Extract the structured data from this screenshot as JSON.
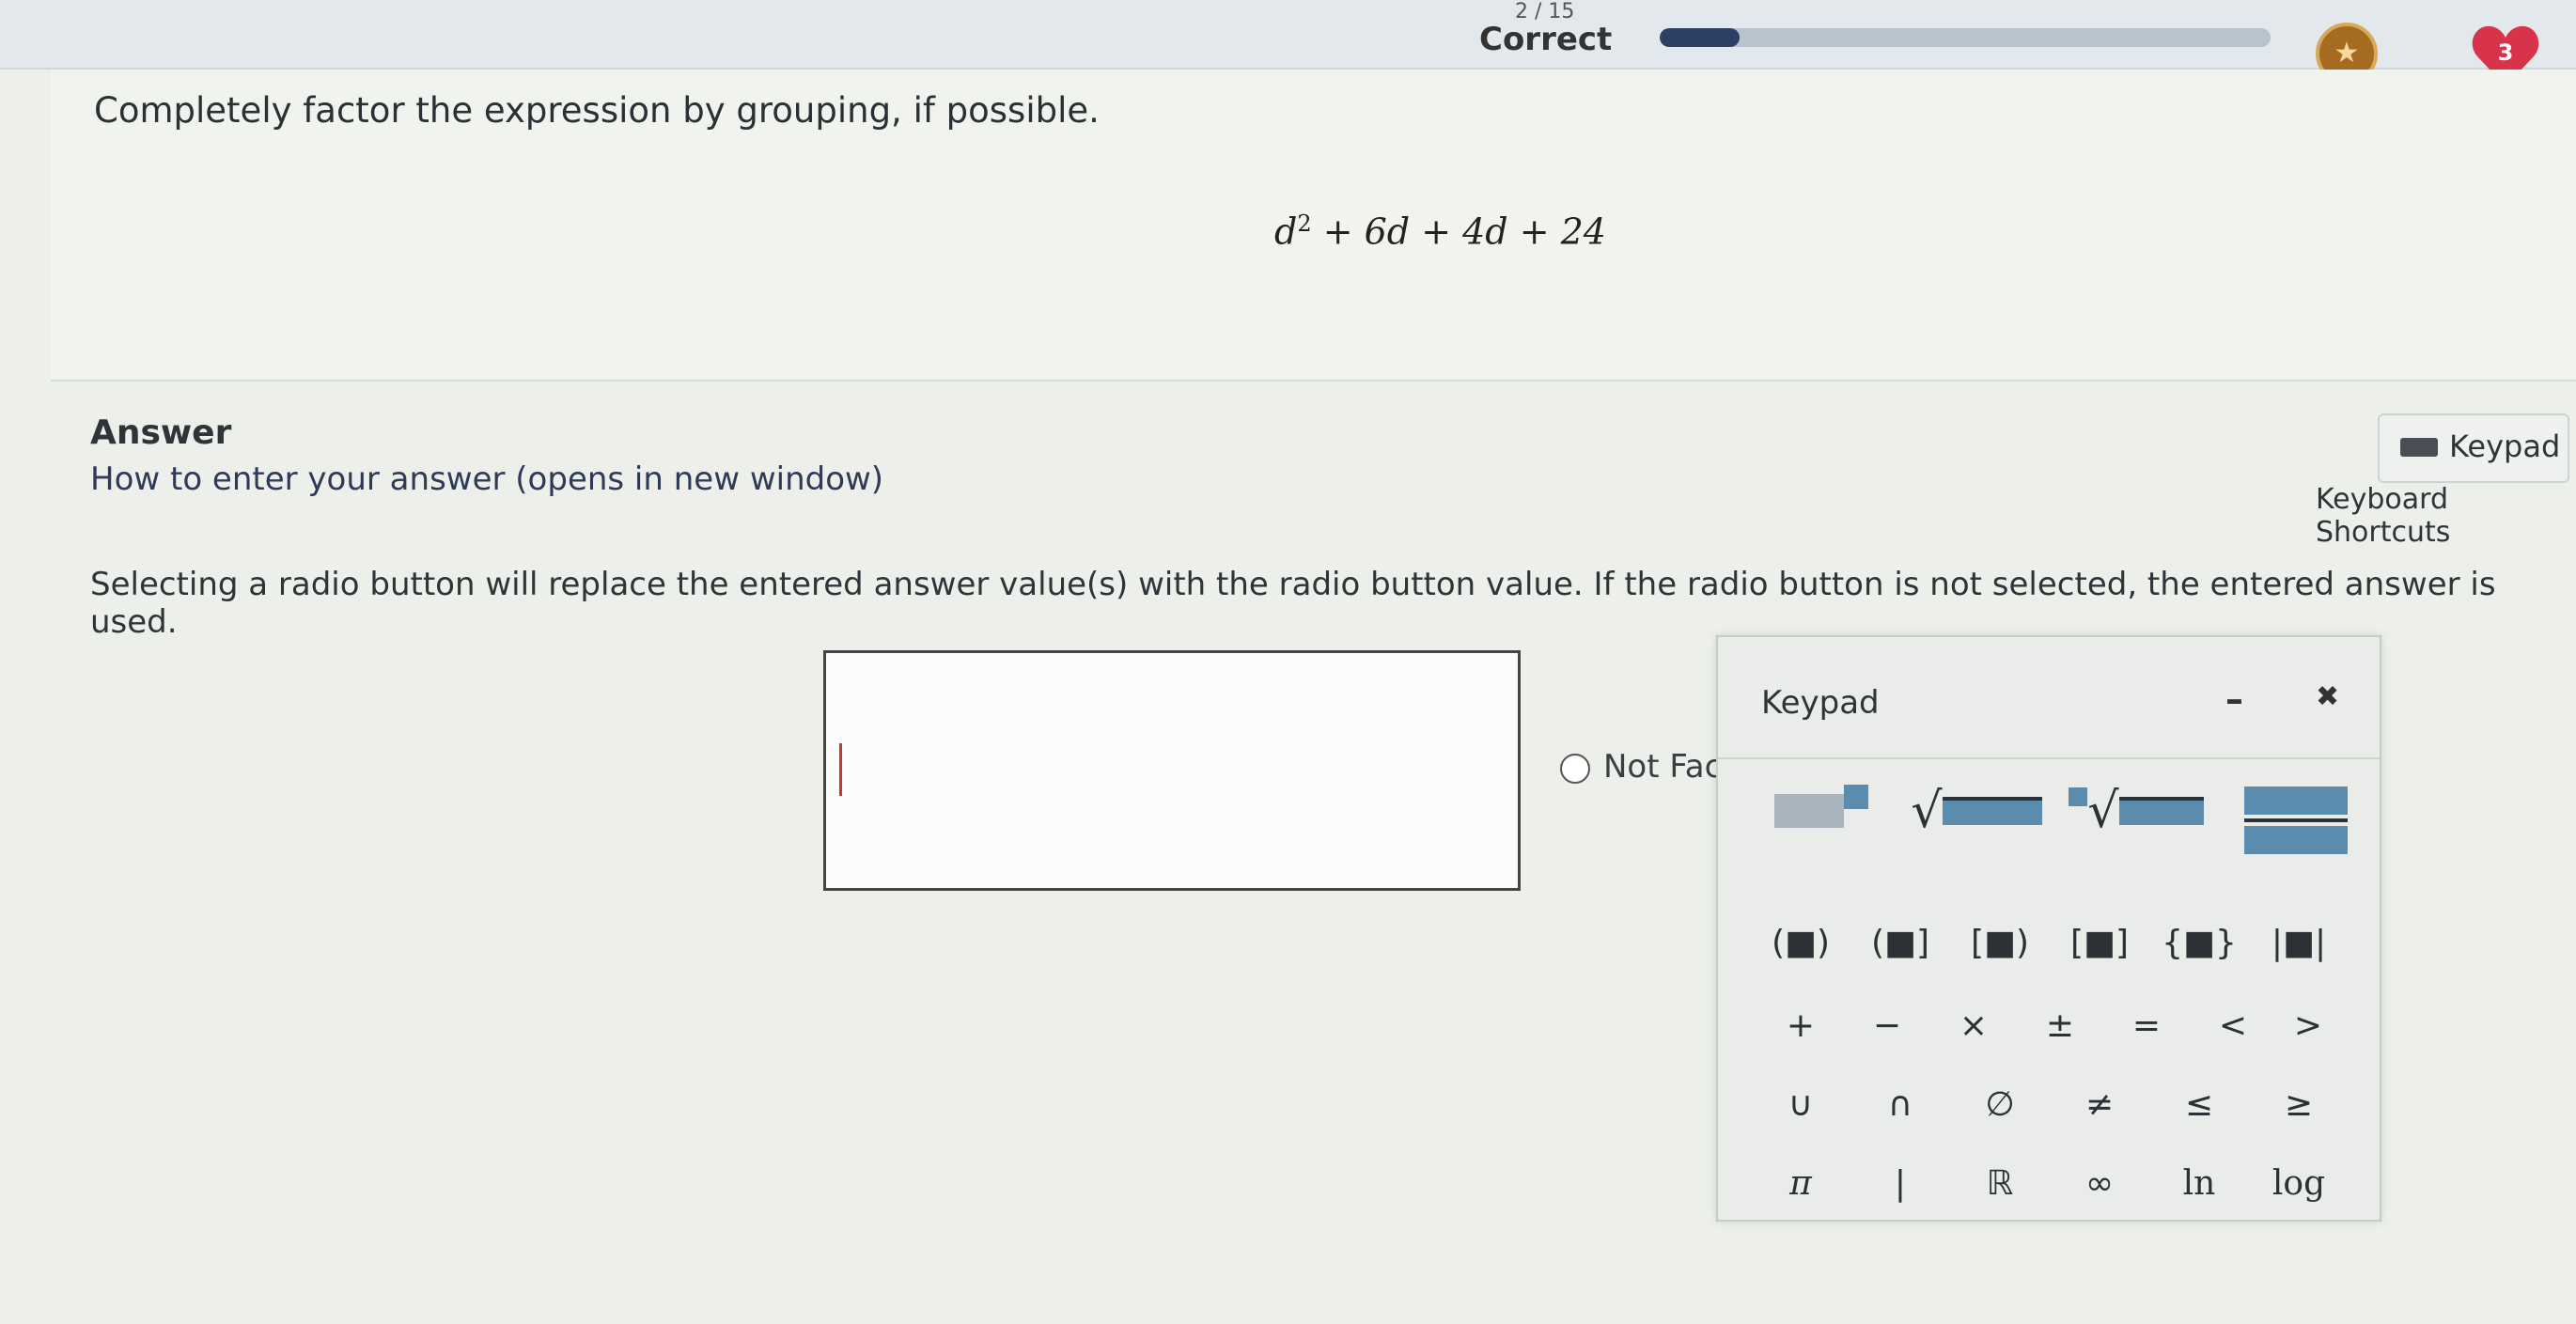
{
  "topbar": {
    "counter": "2 / 15",
    "status": "Correct",
    "progress_fraction": 0.13,
    "streak_icon": "streak-medal-icon",
    "hearts_count": "3"
  },
  "question": {
    "prompt": "Completely factor the expression by grouping, if possible.",
    "expression": {
      "base": "d",
      "exponent": "2",
      "rest": "+ 6d + 4d + 24"
    }
  },
  "answer": {
    "label": "Answer",
    "how_to_link": "How to enter your answer (opens in new window)",
    "keypad_button": "Keypad",
    "shortcuts_link": "Keyboard Shortcuts",
    "instructions": "Selecting a radio button will replace the entered answer value(s) with the radio button value. If the radio button is not selected, the entered answer is used.",
    "input_value": "",
    "radio_option": "Not Facto"
  },
  "keypad": {
    "title": "Keypad",
    "minimize_glyph": "–",
    "close_glyph": "✖",
    "row_templates": [
      "exponent",
      "sqrt",
      "nth-root",
      "fraction"
    ],
    "row_grouping": [
      "(■)",
      "(■]",
      "[■)",
      "[■]",
      "{■}",
      "|■|"
    ],
    "row_operators": [
      "+",
      "−",
      "×",
      "±",
      "=",
      "<",
      ">"
    ],
    "row_sets": [
      "∪",
      "∩",
      "∅",
      "≠",
      "≤",
      "≥"
    ],
    "row_constants": [
      "π",
      "|",
      "ℝ",
      "∞",
      "ln",
      "log"
    ]
  },
  "colors": {
    "accent": "#2e3f66",
    "template_box": "#5b8cad",
    "heart": "#d9334c",
    "caret": "#cc3333"
  }
}
